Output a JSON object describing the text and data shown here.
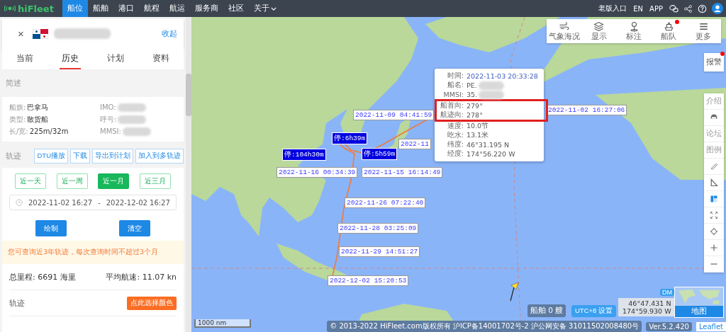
{
  "nav": {
    "logo": "hiFleet",
    "items": [
      {
        "label": "船位",
        "selected": true
      },
      {
        "label": "船舶",
        "selected": false
      },
      {
        "label": "港口",
        "selected": false
      },
      {
        "label": "航程",
        "selected": false
      },
      {
        "label": "航运",
        "selected": false
      },
      {
        "label": "服务商",
        "selected": false
      },
      {
        "label": "社区",
        "selected": false
      },
      {
        "label": "关于",
        "selected": false,
        "dropdown": true
      }
    ],
    "right_links": [
      "老版入口",
      "EN",
      "APP"
    ]
  },
  "ship_panel": {
    "collapse": "收起",
    "close": "×",
    "tabs": [
      {
        "label": "当前",
        "selected": false
      },
      {
        "label": "历史",
        "selected": true
      },
      {
        "label": "计划",
        "selected": false
      },
      {
        "label": "资料",
        "selected": false
      }
    ],
    "summary_title": "简述",
    "info_left": [
      {
        "label": "船旗:",
        "value": "巴拿马"
      },
      {
        "label": "类型:",
        "value": "散货船"
      },
      {
        "label": "长/宽:",
        "value": "225m/32m"
      }
    ],
    "info_right": [
      {
        "label": "IMO:"
      },
      {
        "label": "呼号:"
      },
      {
        "label": "MMSI:"
      }
    ],
    "track_title": "轨迹",
    "track_actions": [
      "DTU播放",
      "下载",
      "导出到计划",
      "加入到多轨迹"
    ],
    "ranges": [
      {
        "label": "近一天",
        "selected": false
      },
      {
        "label": "近一周",
        "selected": false
      },
      {
        "label": "近一月",
        "selected": true
      },
      {
        "label": "近三月",
        "selected": false
      }
    ],
    "date_start": "2022-11-02 16:27",
    "date_sep": "-",
    "date_end": "2022-12-02 16:27",
    "buttons": [
      "绘制",
      "清空"
    ],
    "notice": "您可查询近3年轨迹，每次查询时间不超过3个月",
    "total_distance": "总里程: 6691 海里",
    "avg_speed": "平均航速: 11.07 kn",
    "track_color_label": "轨迹",
    "track_color_button": "点此选择颜色"
  },
  "map": {
    "toolbar": [
      {
        "label": "气象海况",
        "badge": false
      },
      {
        "label": "显示",
        "badge": false
      },
      {
        "label": "标注",
        "badge": false
      },
      {
        "label": "船队",
        "badge": true
      },
      {
        "label": "更多",
        "badge": false
      }
    ],
    "alarm": {
      "label": "报警",
      "badge": true
    },
    "side_tools": [
      {
        "kind": "text",
        "label": "介绍"
      },
      {
        "kind": "icon"
      },
      {
        "kind": "text",
        "label": "论坛"
      },
      {
        "kind": "text",
        "label": "图例"
      },
      {
        "kind": "icon"
      },
      {
        "kind": "icon"
      },
      {
        "kind": "icon"
      },
      {
        "kind": "icon"
      },
      {
        "kind": "icon"
      },
      {
        "kind": "icon"
      },
      {
        "kind": "icon"
      }
    ],
    "track_labels": [
      {
        "kind": "time",
        "text": "2022-11-02 16:27:06"
      },
      {
        "kind": "time",
        "text": "2022-11-09 04:41:59"
      },
      {
        "kind": "time",
        "text": "2022-11"
      },
      {
        "kind": "stop",
        "text": "停:6h39m"
      },
      {
        "kind": "stop",
        "text": "停:104h30m"
      },
      {
        "kind": "stop",
        "text": "停:5h59m"
      },
      {
        "kind": "time",
        "text": "2022-11-16 00:34:39"
      },
      {
        "kind": "time",
        "text": "2022-11-15 16:14:49"
      },
      {
        "kind": "time",
        "text": "2022-11-26 07:22:40"
      },
      {
        "kind": "time",
        "text": "2022-11-28 03:25:09"
      },
      {
        "kind": "time",
        "text": "2022-11-29 14:51:27"
      },
      {
        "kind": "time",
        "text": "2022-12-02 15:20:53"
      }
    ],
    "popup": {
      "rows_before": [
        {
          "kind": "time",
          "label": "时间:",
          "value": "2022-11-03 20:33:28"
        },
        {
          "kind": "redacted",
          "label": "船名:",
          "value": "PE."
        },
        {
          "kind": "redacted",
          "label": "MMSI:",
          "value": "35."
        }
      ],
      "highlighted": [
        {
          "label": "船首向:",
          "value": "279°"
        },
        {
          "label": "航迹向:",
          "value": "278°"
        }
      ],
      "rows_after": [
        {
          "label": "速度:",
          "value": "10.0节"
        },
        {
          "label": "吃水:",
          "value": "13.1米"
        },
        {
          "label": "纬度:",
          "value": "46°31.195 N"
        },
        {
          "label": "经度:",
          "value": "174°56.220 W"
        }
      ]
    },
    "ship_count": "船舶 0 艘",
    "timezone": "UTC+8 设置",
    "coord_mode": "DM",
    "lat": "46°47.431 N",
    "lon": "174°59.930 W",
    "minimap_label": "地图",
    "scale": "1000 nm",
    "copyright": "© 2013-2022 HiFleet.com版权所有 沪ICP备14001702号-2 沪公网安备 31011502008480号",
    "version": "Ver.5.2.420",
    "attribution": "Leaflet"
  }
}
